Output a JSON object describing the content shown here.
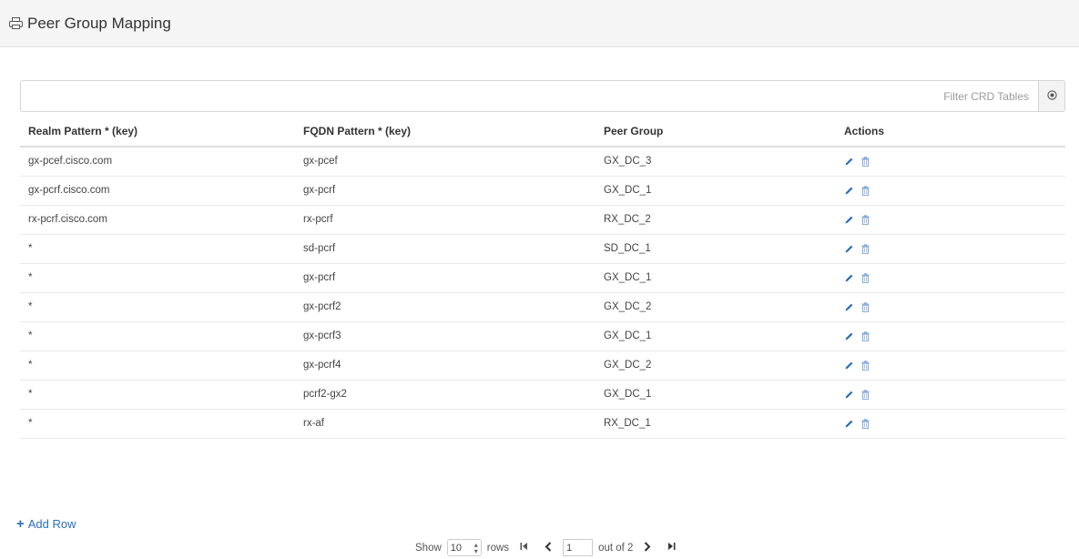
{
  "header": {
    "title": "Peer Group Mapping",
    "icon": "printer-icon"
  },
  "filter": {
    "placeholder": "Filter CRD Tables",
    "clear_icon": "clear-circle-icon"
  },
  "table": {
    "columns": [
      "Realm Pattern * (key)",
      "FQDN Pattern * (key)",
      "Peer Group",
      "Actions"
    ],
    "rows": [
      [
        "gx-pcef.cisco.com",
        "gx-pcef",
        "GX_DC_3"
      ],
      [
        "gx-pcrf.cisco.com",
        "gx-pcrf",
        "GX_DC_1"
      ],
      [
        "rx-pcrf.cisco.com",
        "rx-pcrf",
        "RX_DC_2"
      ],
      [
        "*",
        "sd-pcrf",
        "SD_DC_1"
      ],
      [
        "*",
        "gx-pcrf",
        "GX_DC_1"
      ],
      [
        "*",
        "gx-pcrf2",
        "GX_DC_2"
      ],
      [
        "*",
        "gx-pcrf3",
        "GX_DC_1"
      ],
      [
        "*",
        "gx-pcrf4",
        "GX_DC_2"
      ],
      [
        "*",
        "pcrf2-gx2",
        "GX_DC_1"
      ],
      [
        "*",
        "rx-af",
        "RX_DC_1"
      ]
    ],
    "action_icons": [
      "pencil-icon",
      "trash-icon"
    ]
  },
  "footer": {
    "add_row": "Add Row",
    "show_label": "Show",
    "rows_per_page": "10",
    "rows_label": "rows",
    "page": "1",
    "out_of": "out of 2"
  },
  "colors": {
    "link": "#2a6ebb",
    "header_bg": "#f5f5f5"
  }
}
